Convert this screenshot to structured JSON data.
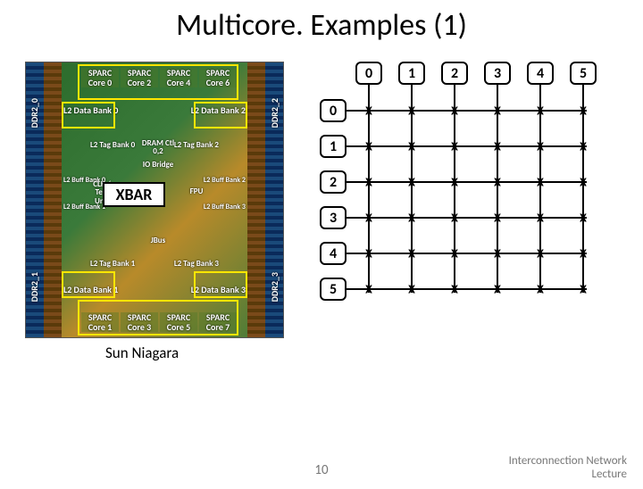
{
  "title": "Multicore. Examples (1)",
  "die": {
    "ddr_left_top": "DDR2_0",
    "ddr_left_bot": "DDR2_1",
    "ddr_right_top": "DDR2_2",
    "ddr_right_bot": "DDR2_3",
    "cores_top": [
      "SPARC\nCore 0",
      "SPARC\nCore 2",
      "SPARC\nCore 4",
      "SPARC\nCore 6"
    ],
    "cores_bot": [
      "SPARC\nCore 1",
      "SPARC\nCore 3",
      "SPARC\nCore 5",
      "SPARC\nCore 7"
    ],
    "l2_data_left_top": "L2 Data\nBank 0",
    "l2_data_right_top": "L2 Data\nBank 2",
    "l2_data_left_bot": "L2 Data\nBank 1",
    "l2_data_right_bot": "L2 Data\nBank 3",
    "l2_tag_left_top": "L2 Tag\nBank 0",
    "l2_tag_right_top": "L2 Tag\nBank 2",
    "l2_tag_left_bot": "L2 Tag\nBank 1",
    "l2_tag_right_bot": "L2 Tag\nBank 3",
    "l2_buf_left_top": "L2 Buff\nBank 0",
    "l2_buf_right_top": "L2 Buff\nBank 2",
    "l2_buf_left_bot": "L2 Buff\nBank 1",
    "l2_buf_right_bot": "L2 Buff\nBank 3",
    "dram_ctl": "DRAM\nCtl 0,2",
    "io_bridge": "IO\nBridge",
    "clk_test": "CLK /\nTest\nUnit",
    "fpu": "FPU",
    "jbus": "JBus",
    "xbar": "XBAR"
  },
  "sun_caption": "Sun Niagara",
  "crossbar": {
    "cols": [
      "0",
      "1",
      "2",
      "3",
      "4",
      "5"
    ],
    "rows": [
      "0",
      "1",
      "2",
      "3",
      "4",
      "5"
    ],
    "marker": "X"
  },
  "page_number": "10",
  "footer": {
    "line1": "Interconnection Network",
    "line2": "Lecture"
  }
}
